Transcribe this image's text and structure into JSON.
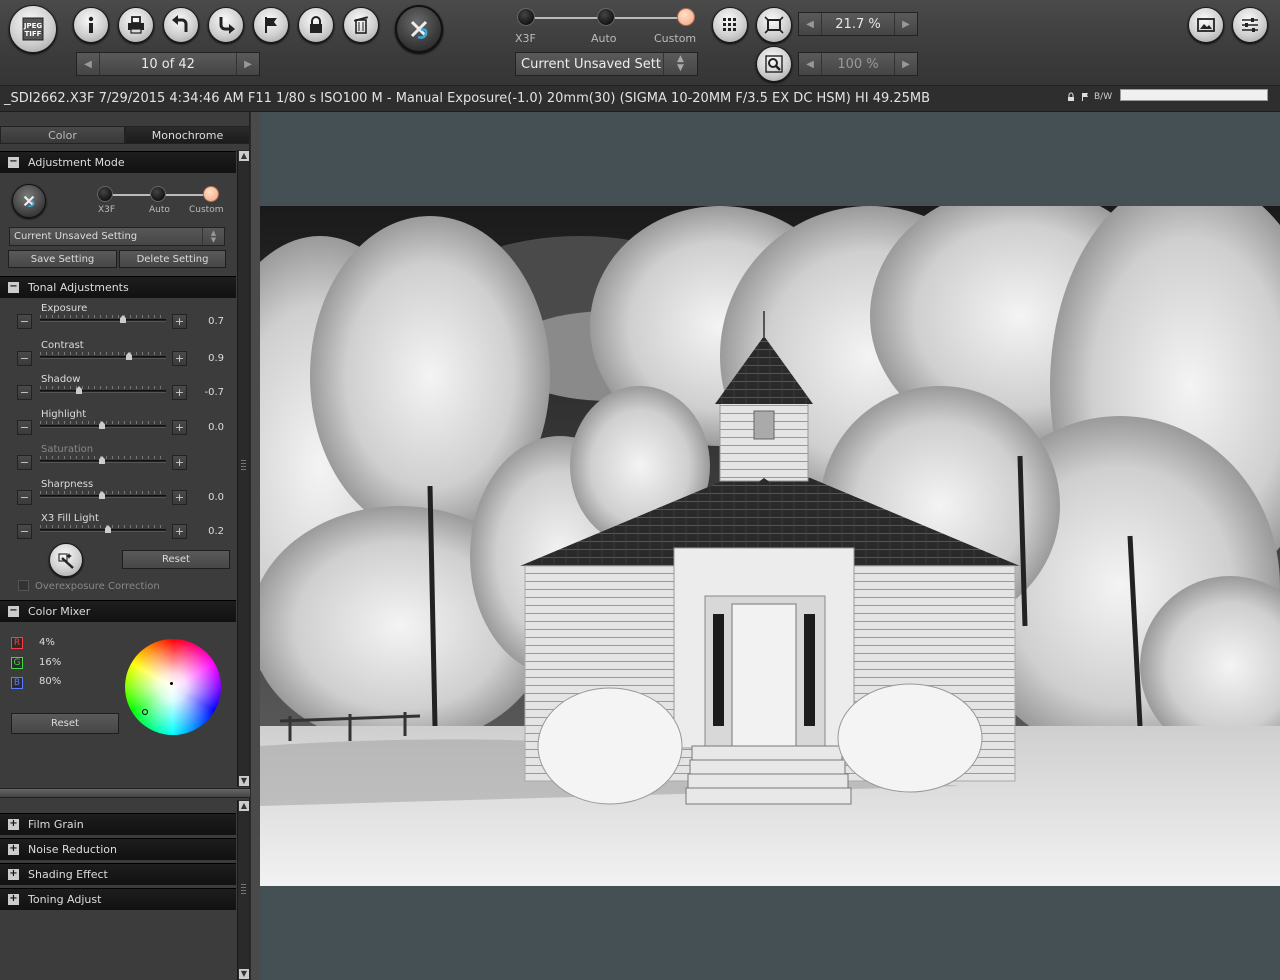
{
  "toolbar": {
    "jpeg_tiff_label_top": "JPEG",
    "jpeg_tiff_label_bottom": "TIFF",
    "image_counter": "10 of 42",
    "mode_labels": [
      "X3F",
      "Auto",
      "Custom"
    ],
    "active_mode": "Custom",
    "preset_value": "Current Unsaved Sett",
    "zoom_fit": "21.7 %",
    "zoom_actual": "100 %",
    "icons": [
      "jpeg-tiff-icon",
      "info-icon",
      "print-icon",
      "rotate-left-icon",
      "rotate-right-icon",
      "flag-icon",
      "lock-icon",
      "trash-icon",
      "x3-logo-icon",
      "grid-icon",
      "fit-frame-icon",
      "zoom-icon",
      "slideshow-icon",
      "settings-sliders-icon"
    ]
  },
  "infobar": {
    "text": "_SDI2662.X3F 7/29/2015 4:34:46 AM F11 1/80 s ISO100 M - Manual Exposure(-1.0) 20mm(30) (SIGMA 10-20MM F/3.5 EX DC HSM) HI 49.25MB",
    "mode_badge": "B/W"
  },
  "left": {
    "tabs": [
      "Color",
      "Monochrome"
    ],
    "active_tab": "Monochrome",
    "adjustment_mode": {
      "title": "Adjustment Mode",
      "mode_labels": [
        "X3F",
        "Auto",
        "Custom"
      ],
      "setting": "Current Unsaved Setting",
      "save_label": "Save Setting",
      "delete_label": "Delete Setting"
    },
    "tonal": {
      "title": "Tonal Adjustments",
      "sliders": [
        {
          "label": "Exposure",
          "value": "0.7",
          "position": 0.66,
          "enabled": true
        },
        {
          "label": "Contrast",
          "value": "0.9",
          "position": 0.71,
          "enabled": true
        },
        {
          "label": "Shadow",
          "value": "-0.7",
          "position": 0.31,
          "enabled": true
        },
        {
          "label": "Highlight",
          "value": "0.0",
          "position": 0.49,
          "enabled": true
        },
        {
          "label": "Saturation",
          "value": "",
          "position": 0.49,
          "enabled": false
        },
        {
          "label": "Sharpness",
          "value": "0.0",
          "position": 0.49,
          "enabled": true
        },
        {
          "label": "X3 Fill Light",
          "value": "0.2",
          "position": 0.54,
          "enabled": true
        }
      ],
      "reset_label": "Reset",
      "overexposure_label": "Overexposure Correction"
    },
    "color_mixer": {
      "title": "Color Mixer",
      "channels": [
        {
          "key": "R",
          "value": "4%",
          "color": "#ff3b3b"
        },
        {
          "key": "G",
          "value": "16%",
          "color": "#46d846"
        },
        {
          "key": "B",
          "value": "80%",
          "color": "#5a7dff"
        }
      ],
      "reset_label": "Reset"
    },
    "collapsed_sections": [
      "Film Grain",
      "Noise Reduction",
      "Shading Effect",
      "Toning Adjust"
    ]
  },
  "colors": {
    "accent_mode_dot": "#f2a37e",
    "preview_bg": "#455054"
  }
}
